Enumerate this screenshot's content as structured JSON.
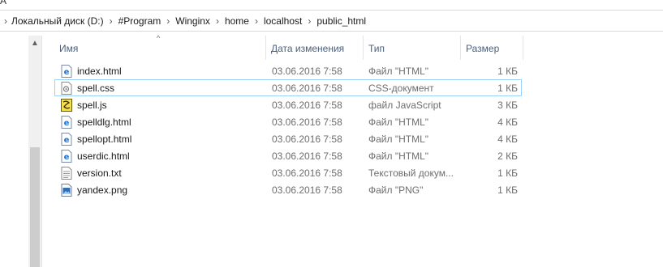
{
  "window": {
    "title_fragment": "A"
  },
  "address": {
    "segments": [
      "Локальный диск (D:)",
      "#Program",
      "Winginx",
      "home",
      "localhost",
      "public_html"
    ]
  },
  "columns": {
    "name": "Имя",
    "date": "Дата изменения",
    "type": "Тип",
    "size": "Размер"
  },
  "files": [
    {
      "name": "index.html",
      "date": "03.06.2016 7:58",
      "type": "Файл \"HTML\"",
      "size": "1 КБ",
      "icon": "html-file-icon"
    },
    {
      "name": "spell.css",
      "date": "03.06.2016 7:58",
      "type": "CSS-документ",
      "size": "1 КБ",
      "icon": "css-file-icon"
    },
    {
      "name": "spell.js",
      "date": "03.06.2016 7:58",
      "type": "файл JavaScript",
      "size": "3 КБ",
      "icon": "js-file-icon"
    },
    {
      "name": "spelldlg.html",
      "date": "03.06.2016 7:58",
      "type": "Файл \"HTML\"",
      "size": "4 КБ",
      "icon": "html-file-icon"
    },
    {
      "name": "spellopt.html",
      "date": "03.06.2016 7:58",
      "type": "Файл \"HTML\"",
      "size": "4 КБ",
      "icon": "html-file-icon"
    },
    {
      "name": "userdic.html",
      "date": "03.06.2016 7:58",
      "type": "Файл \"HTML\"",
      "size": "2 КБ",
      "icon": "html-file-icon"
    },
    {
      "name": "version.txt",
      "date": "03.06.2016 7:58",
      "type": "Текстовый докум...",
      "size": "1 КБ",
      "icon": "text-file-icon"
    },
    {
      "name": "yandex.png",
      "date": "03.06.2016 7:58",
      "type": "Файл \"PNG\"",
      "size": "1 КБ",
      "icon": "image-file-icon"
    }
  ],
  "selected_file": "spell.css",
  "colors": {
    "selection_border": "#99d1ff",
    "header_text": "#4c607a",
    "detail_text": "#6d6d6d"
  }
}
